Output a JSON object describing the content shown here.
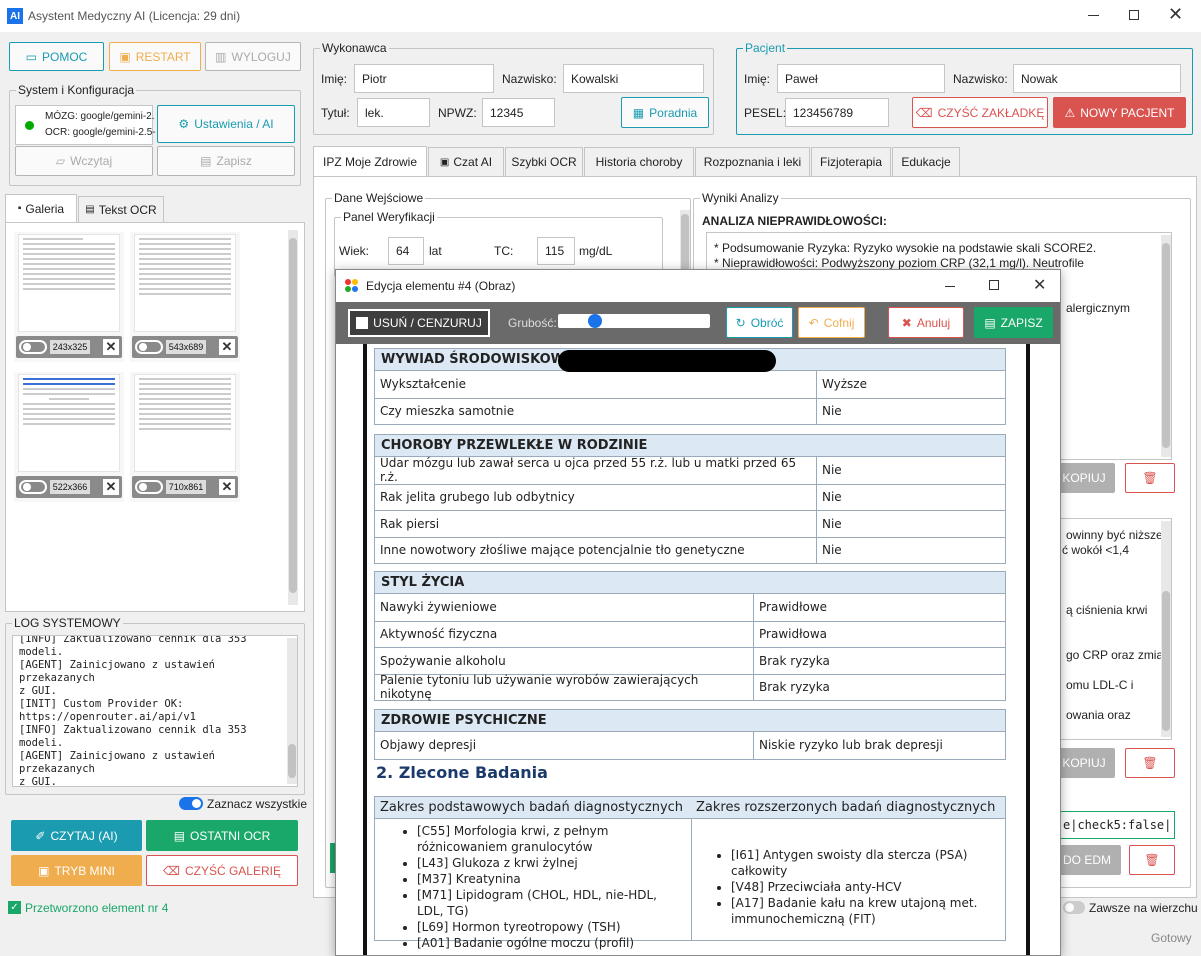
{
  "app": {
    "logo": "AI",
    "title": "Asystent Medyczny AI (Licencja: 29 dni)"
  },
  "colors": {
    "teal": "#1a9bb0",
    "green": "#19a86a",
    "orange": "#f0ad4e",
    "red": "#d9534f",
    "blue": "#1a73e8"
  },
  "toolbar": {
    "help": "POMOC",
    "restart": "RESTART",
    "logout": "WYLOGUJ"
  },
  "system": {
    "title": "System i Konfiguracja",
    "brain": "MÓZG: google/gemini-2.",
    "ocr": "OCR: google/gemini-2.5-",
    "settings": "Ustawienia / AI",
    "load": "Wczytaj",
    "save": "Zapisz"
  },
  "left_tabs": {
    "gallery": "Galeria",
    "ocr_text": "Tekst OCR"
  },
  "thumbs": [
    "243x325",
    "543x689",
    "522x366",
    "710x861"
  ],
  "log": {
    "title": "LOG SYSTEMOWY",
    "lines": [
      "[INFO] Zaktualizowano cennik dla 353 modeli.",
      "[AGENT] Zainicjowano z ustawień przekazanych",
      "z GUI.",
      "[INIT] Custom Provider OK:",
      "https://openrouter.ai/api/v1",
      "[INFO] Zaktualizowano cennik dla 353 modeli.",
      "[AGENT] Zainicjowano z ustawień przekazanych",
      "z GUI.",
      "[INIT] Custom Provider OK:",
      "https://openrouter.ai/api/v1"
    ]
  },
  "select_all": "Zaznacz wszystkie",
  "actions": {
    "read": "CZYTAJ (AI)",
    "last_ocr": "OSTATNI OCR",
    "mini": "TRYB MINI",
    "clear": "CZYŚĆ GALERIĘ"
  },
  "status": "Przetworzono element nr 4",
  "performer": {
    "title": "Wykonawca",
    "first_label": "Imię:",
    "first": "Piotr",
    "last_label": "Nazwisko:",
    "last": "Kowalski",
    "title_label": "Tytuł:",
    "title_val": "lek.",
    "npwz_label": "NPWZ:",
    "npwz": "12345",
    "clinic": "Poradnia"
  },
  "patient": {
    "title": "Pacjent",
    "first_label": "Imię:",
    "first": "Paweł",
    "last_label": "Nazwisko:",
    "last": "Nowak",
    "pesel_label": "PESEL:",
    "pesel": "123456789",
    "clear_tab": "CZYŚĆ ZAKŁADKĘ",
    "new_patient": "NOWY PACJENT"
  },
  "tabs": [
    "IPZ Moje Zdrowie",
    "Czat AI",
    "Szybki OCR",
    "Historia choroby",
    "Rozpoznania i leki",
    "Fizjoterapia",
    "Edukacje"
  ],
  "input_data": {
    "title": "Dane Wejściowe",
    "panel": "Panel Weryfikacji",
    "age_label": "Wiek:",
    "age": "64",
    "age_unit": "lat",
    "tc_label": "TC:",
    "tc": "115",
    "tc_unit": "mg/dL"
  },
  "results": {
    "title": "Wyniki Analizy",
    "heading": "ANALIZA NIEPRAWIDŁOWOŚCI:",
    "line1": "* Podsumowanie Ryzyka: Ryzyko wysokie na podstawie skali SCORE2.",
    "line2": "* Nieprawidłowości: Podwyższony poziom CRP (32,1 mg/l). Neutrofile",
    "frag1": "alergicznym",
    "copy": "KOPIUJ",
    "frag2": "owinny być niższe",
    "frag3": "ć wokół <1,4",
    "frag4": "ą ciśnienia krwi",
    "frag5": "go CRP oraz zmian",
    "frag6": "omu LDL-C i",
    "frag7": "owania oraz",
    "code": "e|check5:false|",
    "edm": "DO EDM"
  },
  "always_top": "Zawsze na wierzchu",
  "ready": "Gotowy",
  "dialog": {
    "title": "Edycja elementu #4 (Obraz)",
    "remove": "USUŃ / CENZURUJ",
    "thickness": "Grubość:",
    "thickness_value": 0.22,
    "rotate": "Obróć",
    "undo": "Cofnij",
    "cancel": "Anuluj",
    "save": "ZAPISZ"
  },
  "doc": {
    "env": {
      "title": "WYWIAD ŚRODOWISKOWY",
      "rows": [
        [
          "Wykształcenie",
          "Wyższe"
        ],
        [
          "Czy mieszka samotnie",
          "Nie"
        ]
      ]
    },
    "family": {
      "title": "CHOROBY PRZEWLEKŁE W RODZINIE",
      "rows": [
        [
          "Udar mózgu lub zawał serca u ojca przed 55 r.ż. lub u matki przed 65 r.ż.",
          "Nie"
        ],
        [
          "Rak jelita grubego lub odbytnicy",
          "Nie"
        ],
        [
          "Rak piersi",
          "Nie"
        ],
        [
          "Inne nowotwory złośliwe mające potencjalnie tło genetyczne",
          "Nie"
        ]
      ]
    },
    "lifestyle": {
      "title": "STYL ŻYCIA",
      "rows": [
        [
          "Nawyki żywieniowe",
          "Prawidłowe"
        ],
        [
          "Aktywność fizyczna",
          "Prawidłowa"
        ],
        [
          "Spożywanie alkoholu",
          "Brak ryzyka"
        ],
        [
          "Palenie tytoniu lub używanie wyrobów zawierających nikotynę",
          "Brak ryzyka"
        ]
      ]
    },
    "mental": {
      "title": "ZDROWIE PSYCHICZNE",
      "rows": [
        [
          "Objawy depresji",
          "Niskie ryzyko lub brak depresji"
        ]
      ]
    },
    "tests_title": "2. Zlecone Badania",
    "basic_head": "Zakres podstawowych badań diagnostycznych",
    "ext_head": "Zakres rozszerzonych badań diagnostycznych",
    "basic": [
      "[C55] Morfologia krwi, z pełnym różnicowaniem granulocytów",
      "[L43] Glukoza z krwi żylnej",
      "[M37] Kreatynina",
      "[M71] Lipidogram (CHOL, HDL, nie-HDL, LDL, TG)",
      "[L69] Hormon tyreotropowy (TSH)",
      "[A01] Badanie ogólne moczu (profil)"
    ],
    "ext": [
      "[I61] Antygen swoisty dla stercza (PSA) całkowity",
      "[V48] Przeciwciała anty-HCV",
      "[A17] Badanie kału na krew utajoną met. immunochemiczną (FIT)"
    ]
  }
}
